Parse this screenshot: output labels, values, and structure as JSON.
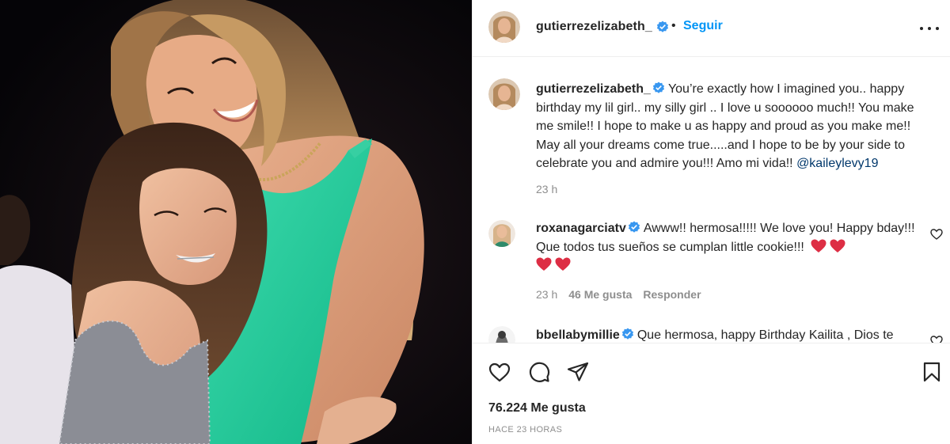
{
  "post": {
    "username": "gutierrezelizabeth_",
    "follow_label": "Seguir",
    "separator": "•",
    "caption": {
      "username": "gutierrezelizabeth_",
      "text": "You’re exactly how I imagined you.. happy birthday my lil girl.. my silly girl .. I love u soooooo much!! You make me smile!! I hope to make u as happy and proud as you make me!! May all your dreams come true.....and I hope to be by your side to celebrate you and admire you!!! Amo mi vida!! ",
      "mention": "@kaileylevy19",
      "time": "23 h"
    },
    "comments": [
      {
        "username": "roxanagarciatv",
        "text": "Awww!! hermosa!!!!! We love you! Happy bday!!! Que todos tus sueños se cumplan little cookie!!! ",
        "time": "23 h",
        "likes": "46 Me gusta",
        "reply_label": "Responder"
      },
      {
        "username": "bbellabymillie",
        "text": "Que hermosa, happy Birthday Kailita , Dios te"
      }
    ],
    "likes_label": "76.224 Me gusta",
    "timestamp": "HACE 23 HORAS"
  },
  "icons": {
    "verified_color": "#3897f0",
    "heart_emoji_color": "#dd2e44",
    "follow_color": "#0095f6",
    "mention_color": "#00376b",
    "names": [
      "verified-icon",
      "more-options-icon",
      "like-icon",
      "comment-icon",
      "share-icon",
      "save-icon",
      "heart-emoji-icon",
      "comment-like-icon"
    ]
  }
}
